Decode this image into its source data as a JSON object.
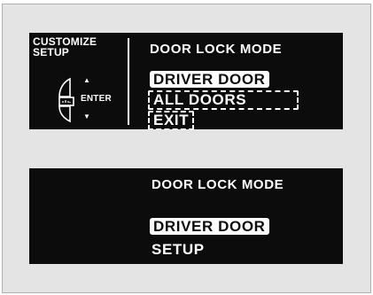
{
  "top_panel": {
    "side_label": "CUSTOMIZE\nSETUP",
    "enter_label": "ENTER",
    "up_arrow": "▲",
    "down_arrow": "▼",
    "knob_icon": "selector-knob-icon",
    "menu_title": "DOOR LOCK MODE",
    "options": [
      {
        "label": "DRIVER DOOR",
        "state": "selected"
      },
      {
        "label": "ALL DOORS",
        "state": "option"
      },
      {
        "label": "EXIT",
        "state": "option"
      }
    ]
  },
  "bottom_panel": {
    "menu_title": "DOOR LOCK MODE",
    "selected_value": "DRIVER DOOR",
    "sub_label": "SETUP"
  },
  "colors": {
    "screen_bg": "#0c0c0c",
    "text": "#ffffff",
    "frame_bg": "#e4e4e4"
  }
}
